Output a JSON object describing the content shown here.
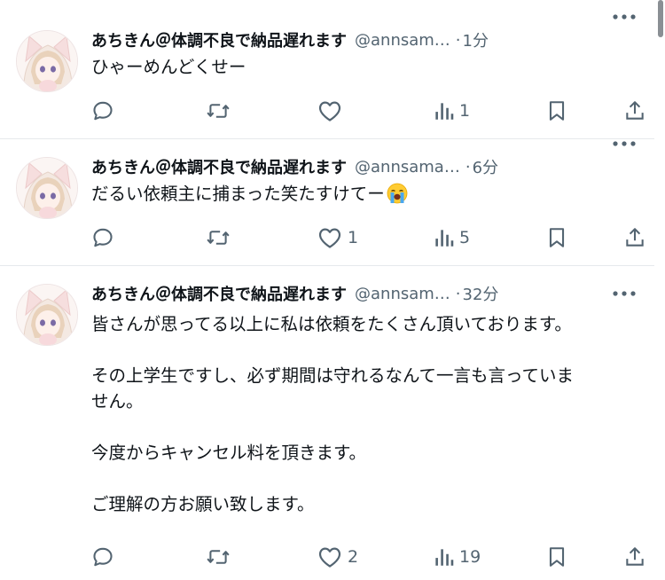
{
  "tweets": [
    {
      "name": "あちきん＠体調不良で納品遅れます",
      "handle": "@annsam…",
      "dot": "·",
      "time": "1分",
      "text_lines": [
        "ひゃーめんどくせー"
      ],
      "emoji": "",
      "counts": {
        "reply": "",
        "retweet": "",
        "like": "",
        "views": "1"
      }
    },
    {
      "name": "あちきん＠体調不良で納品遅れます",
      "handle": "@annsama…",
      "dot": "·",
      "time": "6分",
      "text_lines": [
        "だるい依頼主に捕まった笑たすけてー"
      ],
      "emoji": "loudly-crying-face",
      "counts": {
        "reply": "",
        "retweet": "",
        "like": "1",
        "views": "5"
      }
    },
    {
      "name": "あちきん＠体調不良で納品遅れます",
      "handle": "@annsam…",
      "dot": "·",
      "time": "32分",
      "text_lines": [
        "皆さんが思ってる以上に私は依頼をたくさん頂いております。",
        "",
        "その上学生ですし、必ず期間は守れるなんて一言も言っていま",
        "せん。",
        "",
        "今度からキャンセル料を頂きます。",
        "",
        "ご理解の方お願い致します。"
      ],
      "emoji": "",
      "counts": {
        "reply": "",
        "retweet": "",
        "like": "2",
        "views": "19"
      }
    }
  ],
  "icons": {
    "reply": "reply-icon",
    "retweet": "retweet-icon",
    "like": "heart-icon",
    "views": "views-icon",
    "bookmark": "bookmark-icon",
    "share": "share-icon",
    "more": "more-icon"
  },
  "colors": {
    "text": "#0f1419",
    "secondary": "#536471",
    "divider": "#e6e9ec"
  }
}
